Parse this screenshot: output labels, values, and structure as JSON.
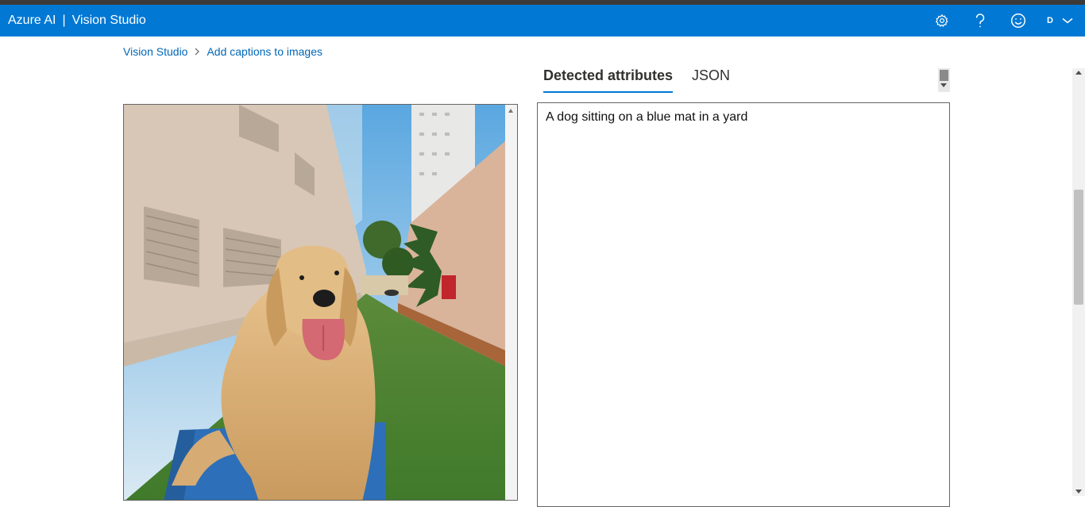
{
  "header": {
    "brand": "Azure AI",
    "separator": "|",
    "app_name": "Vision Studio",
    "icons": [
      "settings-gear-icon",
      "help-question-icon",
      "feedback-smiley-icon",
      "chevron-down-icon"
    ],
    "account_initial": "D"
  },
  "breadcrumb": {
    "items": [
      "Vision Studio",
      "Add captions to images"
    ]
  },
  "tabs": [
    {
      "label": "Detected attributes",
      "active": true
    },
    {
      "label": "JSON",
      "active": false
    }
  ],
  "result": {
    "caption": "A dog sitting on a blue mat in a yard"
  },
  "colors": {
    "header_bg": "#0078d4",
    "link": "#0067b8",
    "tab_underline": "#0078d4"
  }
}
